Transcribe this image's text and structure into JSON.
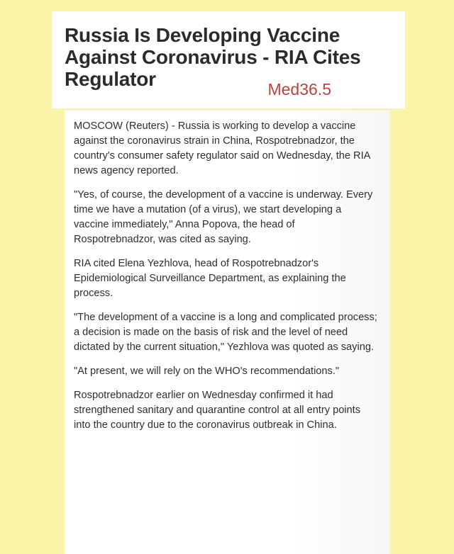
{
  "headline": {
    "title": "Russia Is Developing Vaccine Against Coronavirus - RIA Cites Regulator",
    "source_tag": "Med36.5"
  },
  "article": {
    "paragraphs": [
      "MOSCOW (Reuters) - Russia is working to develop a vaccine against the coronavirus strain in China, Rospotrebnadzor, the country's consumer safety regulator said on Wednesday, the RIA news agency reported.",
      "\"Yes, of course, the development of a vaccine is underway. Every time we have a mutation (of a virus), we start developing a vaccine immediately,\" Anna Popova, the head of Rospotrebnadzor, was cited as saying.",
      "RIA cited Elena Yezhlova, head of Rospotrebnadzor's Epidemiological Surveillance Department, as explaining the process.",
      "\"The development of a vaccine is a long and complicated process; a decision is made on the basis of risk and the level of need dictated by the current situation,\" Yezhlova was quoted as saying.",
      "\"At present, we will rely on the WHO's recommendations.\"",
      "Rospotrebnadzor earlier on Wednesday confirmed it had strengthened sanitary and quarantine control at all entry points into the country due to the coronavirus outbreak in China."
    ]
  },
  "colors": {
    "background": "#fbf4a8",
    "card": "#ffffff",
    "headline_text": "#2b2b2b",
    "source_tag": "#b9453b",
    "body_text": "#2e2e2e"
  }
}
